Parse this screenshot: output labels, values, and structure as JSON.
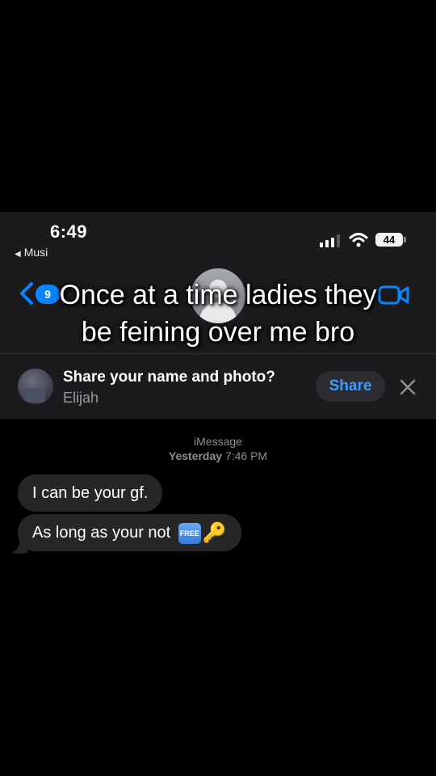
{
  "status_bar": {
    "time": "6:49",
    "back_app": "Musi",
    "battery": "44"
  },
  "nav": {
    "unread_count": "9"
  },
  "caption": {
    "line1": "Once at a time ladies they",
    "line2": "be feining over me bro"
  },
  "share_banner": {
    "title": "Share your name and photo?",
    "name": "Elijah",
    "button": "Share"
  },
  "conversation": {
    "service": "iMessage",
    "day": "Yesterday",
    "time": "7:46 PM",
    "messages": [
      {
        "text": "I can be your gf."
      },
      {
        "text": "As long as your not",
        "emoji_badge": "FREE",
        "emoji_key": "🔑"
      }
    ]
  },
  "colors": {
    "accent": "#0a84ff",
    "header_bg": "#1b1b1d",
    "bubble_bg": "#262629"
  }
}
